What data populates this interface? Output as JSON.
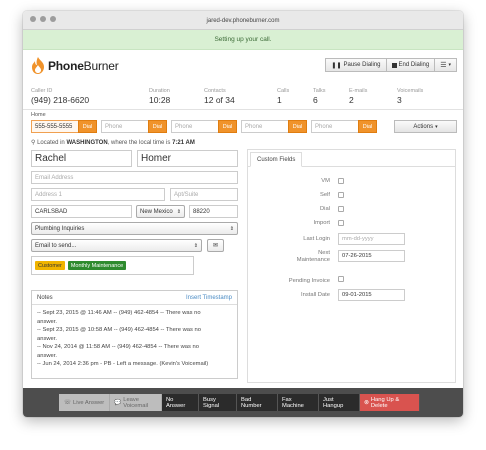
{
  "browser": {
    "url": "jared-dev.phoneburner.com"
  },
  "banner": {
    "text": "Setting up your call."
  },
  "logo": {
    "text_phone": "Phone",
    "text_burner": "Burner"
  },
  "header_buttons": {
    "pause": "Pause Dialing",
    "end": "End Dialing",
    "menu_icon": "list-icon"
  },
  "stats": {
    "caller_id": {
      "label": "Caller ID",
      "value": "(949) 218-6620"
    },
    "duration": {
      "label": "Duration",
      "value": "10:28"
    },
    "contacts": {
      "label": "Contacts",
      "value": "12 of 34"
    },
    "calls": {
      "label": "Calls",
      "value": "1"
    },
    "talks": {
      "label": "Talks",
      "value": "6"
    },
    "emails": {
      "label": "E-mails",
      "value": "2"
    },
    "voicemails": {
      "label": "Voicemails",
      "value": "3"
    }
  },
  "phone_section": {
    "label": "Home",
    "phones": [
      {
        "value": "555-555-5555",
        "dial": "Dial"
      },
      {
        "placeholder": "Phone",
        "dial": "Dial"
      },
      {
        "placeholder": "Phone",
        "dial": "Dial"
      },
      {
        "placeholder": "Phone",
        "dial": "Dial"
      },
      {
        "placeholder": "Phone",
        "dial": "Dial"
      }
    ],
    "actions": "Actions"
  },
  "location": {
    "prefix": "Located in",
    "state": "WASHINGTON",
    "middle": ", where the local time is",
    "time": "7:21 AM"
  },
  "contact": {
    "first_name": "Rachel",
    "last_name": "Homer",
    "email_placeholder": "Email Address",
    "address_placeholder": "Address 1",
    "apt_placeholder": "Apt/Suite",
    "city": "CARLSBAD",
    "state": "New Mexico",
    "zip": "88220",
    "category": "Plumbing Inquiries",
    "email_template": "Email to send...",
    "tags": [
      {
        "label": "Customer",
        "color": "#f0b400"
      },
      {
        "label": "Monthly Maintenance",
        "color": "#2e8b2e"
      }
    ]
  },
  "notes": {
    "title": "Notes",
    "insert_timestamp": "Insert Timestamp",
    "lines": [
      "-- Sept 23, 2015 @ 11:46 AM -- (949) 462-4854 -- There was no",
      "answer.",
      "-- Sept 23, 2015 @ 10:58 AM -- (949) 462-4854 -- There was no",
      "answer.",
      "-- Nov 24, 2014 @ 11:58 AM -- (949) 462-4854 -- There was no",
      "answer.",
      "-- Jun 24, 2014 2:36 pm - PB - Left a message. (Kevin's Voicemail)"
    ]
  },
  "custom_fields": {
    "tab": "Custom Fields",
    "vm": "VM",
    "self": "Self",
    "dial": "Dial",
    "import": "Import",
    "last_login": {
      "label": "Last Login",
      "placeholder": "mm-dd-yyyy"
    },
    "next_maintenance": {
      "label_line1": "Next",
      "label_line2": "Maintenance",
      "value": "07-26-2015"
    },
    "pending_invoice": "Pending Invoice",
    "install_date": {
      "label": "Install Date",
      "value": "09-01-2015"
    }
  },
  "footer": {
    "live_answer": "Live Answer",
    "leave_voicemail": "Leave Voicemail",
    "no_answer": "No Answer",
    "busy_signal": "Busy Signal",
    "bad_number": "Bad Number",
    "fax_machine": "Fax Machine",
    "just_hangup": "Just Hangup",
    "hang_up_delete": "Hang Up & Delete"
  }
}
